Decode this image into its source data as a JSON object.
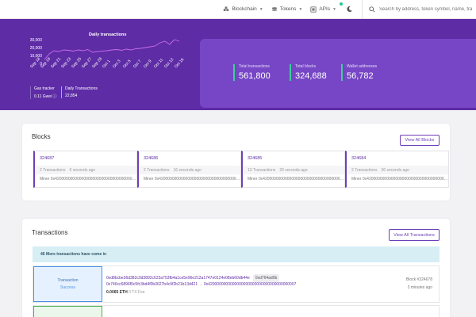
{
  "nav": {
    "blockchain": "Blockchain",
    "tokens": "Tokens",
    "apis": "APIs",
    "search_placeholder": "Search by address, token symbol, name, tra"
  },
  "hero": {
    "chart_title": "Daily transactions",
    "gas_tracker_label": "Gas tracker",
    "gas_tracker_value": "0.11 Gwei",
    "daily_tx_label": "Daily Transactions",
    "daily_tx_value": "22,854",
    "stats": [
      {
        "label": "Total transactions",
        "value": "561,800"
      },
      {
        "label": "Total blocks",
        "value": "324,688"
      },
      {
        "label": "Wallet addresses",
        "value": "56,782"
      }
    ]
  },
  "chart_data": {
    "type": "line",
    "title": "Daily transactions",
    "categories": [
      "Sep 18",
      "Sep 19",
      "Sep 20",
      "Sep 21",
      "Sep 22",
      "Sep 23",
      "Sep 24",
      "Sep 25",
      "Sep 26",
      "Sep 27",
      "Sep 28",
      "Sep 29",
      "Sep 30",
      "Oct 1",
      "Oct 2",
      "Oct 3",
      "Oct 4",
      "Oct 5",
      "Oct 6",
      "Oct 7",
      "Oct 8",
      "Oct 9",
      "Oct 10",
      "Oct 11",
      "Oct 12",
      "Oct 13",
      "Oct 14",
      "Oct 15",
      "Oct 16"
    ],
    "x_tick_labels": [
      "Sep 18",
      "Sep 19",
      "Sep 21",
      "Sep 23",
      "Sep 25",
      "Sep 27",
      "Sep 29",
      "Oct 1",
      "Oct 3",
      "Oct 5",
      "Oct 7",
      "Oct 9",
      "Oct 11",
      "Oct 13",
      "Oct 16"
    ],
    "values": [
      5000,
      12000,
      16000,
      15000,
      17000,
      16500,
      15500,
      17000,
      16000,
      17500,
      14000,
      15000,
      15500,
      16000,
      17000,
      17500,
      16500,
      18000,
      17000,
      18500,
      19000,
      20000,
      21000,
      22000,
      26000,
      28000,
      24000,
      30000,
      28000
    ],
    "y_ticks": [
      "30,000",
      "20,000",
      "10,000",
      "0"
    ],
    "ylim": [
      0,
      30000
    ],
    "line_color": "#c86ee8"
  },
  "blocks": {
    "title": "Blocks",
    "view_all": "View All Blocks",
    "items": [
      {
        "number": "324687",
        "tx": "2 Transactions",
        "time": "6 seconds ago",
        "miner": "Miner 0x4200000000000000000000000000000000000011"
      },
      {
        "number": "324686",
        "tx": "2 Transactions",
        "time": "16 seconds ago",
        "miner": "Miner 0x4200000000000000000000000000000000000011"
      },
      {
        "number": "324685",
        "tx": "13 Transactions",
        "time": "26 seconds ago",
        "miner": "Miner 0x4200000000000000000000000000000000000011"
      },
      {
        "number": "324684",
        "tx": "2 Transactions",
        "time": "36 seconds ago",
        "miner": "Miner 0x4200000000000000000000000000000000000011"
      }
    ]
  },
  "transactions": {
    "title": "Transactions",
    "view_all": "View All Transactions",
    "alert": "46 More transactions have come in",
    "row": {
      "type": "Transaction",
      "status": "Success",
      "hash": "0xd8bcbe36d382c0d3892c623a753fb4a1ce5e96e212a1747e0124e08eb60db44e",
      "method": "0xd764ad0b",
      "from": "0x746cc6896f0c5fc3bd4f0b3627b4c5f2b21b13d421",
      "to": "0x4200000000000000000000000000000000000007",
      "value": "0.0065 ETH",
      "fee": "0 TX Fee",
      "block": "Block #324678",
      "age": "3 minutes ago"
    }
  }
}
